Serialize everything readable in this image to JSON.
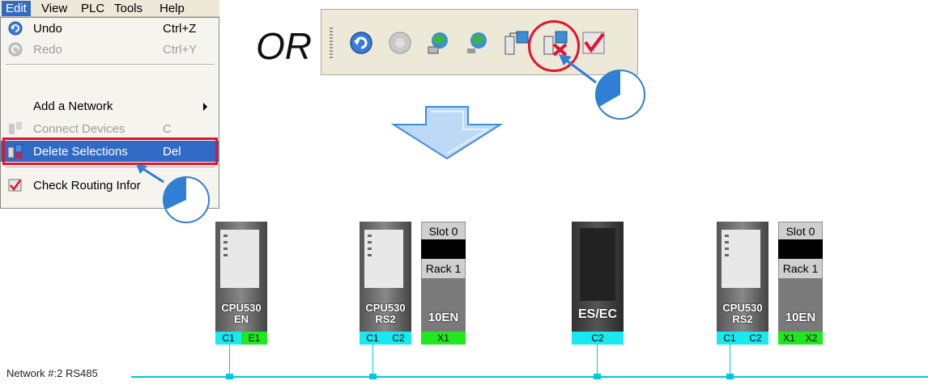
{
  "menubar": {
    "items": [
      "Edit",
      "View",
      "PLC",
      "Tools",
      "Help"
    ]
  },
  "menu": {
    "undo": {
      "label": "Undo",
      "shortcut": "Ctrl+Z"
    },
    "redo": {
      "label": "Redo",
      "shortcut": "Ctrl+Y"
    },
    "add_network": {
      "label": "Add a Network"
    },
    "connect_devices": {
      "label": "Connect Devices",
      "shortcut": "C"
    },
    "delete_selections": {
      "label": "Delete Selections",
      "shortcut": "Del"
    },
    "check_routing": {
      "label": "Check Routing Infor"
    }
  },
  "or_text": "OR",
  "toolbar": {
    "icons": [
      "undo-icon",
      "redo-icon",
      "network-icon",
      "network-alt-icon",
      "connect-devices-icon",
      "delete-selections-icon",
      "check-routing-icon"
    ]
  },
  "network": {
    "label": "Network #:2  RS485",
    "line_color": "#00c8d8"
  },
  "devices": {
    "d1": {
      "name_line1": "CPU530",
      "name_line2": "EN",
      "ports": [
        "C1",
        "E1"
      ]
    },
    "d2": {
      "name_line1": "CPU530",
      "name_line2": "RS2",
      "ports": [
        "C1",
        "C2"
      ],
      "slot": "Slot 0",
      "rack": "Rack 1",
      "module": "10EN",
      "module_port": "X1"
    },
    "d3": {
      "name": "ES/EC",
      "ports": [
        "C2"
      ]
    },
    "d4": {
      "name_line1": "CPU530",
      "name_line2": "RS2",
      "ports": [
        "C1",
        "C2"
      ],
      "slot": "Slot 0",
      "rack": "Rack 1",
      "module": "10EN",
      "module_ports": [
        "X1",
        "X2"
      ]
    }
  },
  "colors": {
    "highlight_red": "#e3122e",
    "menu_selection": "#316ac5",
    "port_cyan": "#18e8f0",
    "port_green": "#1fe81f"
  }
}
